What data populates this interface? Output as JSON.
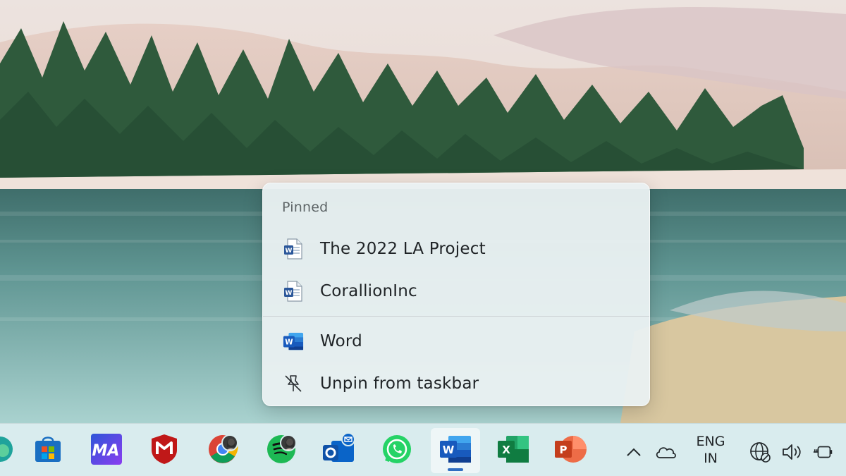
{
  "jumplist": {
    "header": "Pinned",
    "pinned_items": [
      {
        "label": "The 2022 LA Project",
        "icon": "word-document-icon"
      },
      {
        "label": "CorallionInc",
        "icon": "word-document-icon"
      }
    ],
    "actions": [
      {
        "label": "Word",
        "icon": "word-app-icon"
      },
      {
        "label": "Unpin from taskbar",
        "icon": "unpin-icon"
      }
    ]
  },
  "taskbar": {
    "apps": [
      {
        "name": "edge-partial",
        "icon": "edge-icon"
      },
      {
        "name": "microsoft-store",
        "icon": "store-icon"
      },
      {
        "name": "ma-app",
        "icon": "ma-app-icon"
      },
      {
        "name": "mcafee",
        "icon": "mcafee-icon"
      },
      {
        "name": "chrome",
        "icon": "chrome-icon"
      },
      {
        "name": "spotify",
        "icon": "spotify-icon"
      },
      {
        "name": "outlook",
        "icon": "outlook-icon"
      },
      {
        "name": "whatsapp",
        "icon": "whatsapp-icon"
      },
      {
        "name": "word",
        "icon": "word-icon",
        "active": true
      },
      {
        "name": "excel",
        "icon": "excel-icon"
      },
      {
        "name": "powerpoint",
        "icon": "powerpoint-icon"
      }
    ],
    "tray": {
      "language_line1": "ENG",
      "language_line2": "IN",
      "icons": [
        "chevron-up-icon",
        "onedrive-cloud-icon",
        "network-globe-icon",
        "volume-icon",
        "battery-plug-icon"
      ]
    }
  },
  "colors": {
    "word_blue": "#2b579a",
    "excel_green": "#217346",
    "powerpoint_orange": "#d24726",
    "accent": "#2f6ec1"
  }
}
